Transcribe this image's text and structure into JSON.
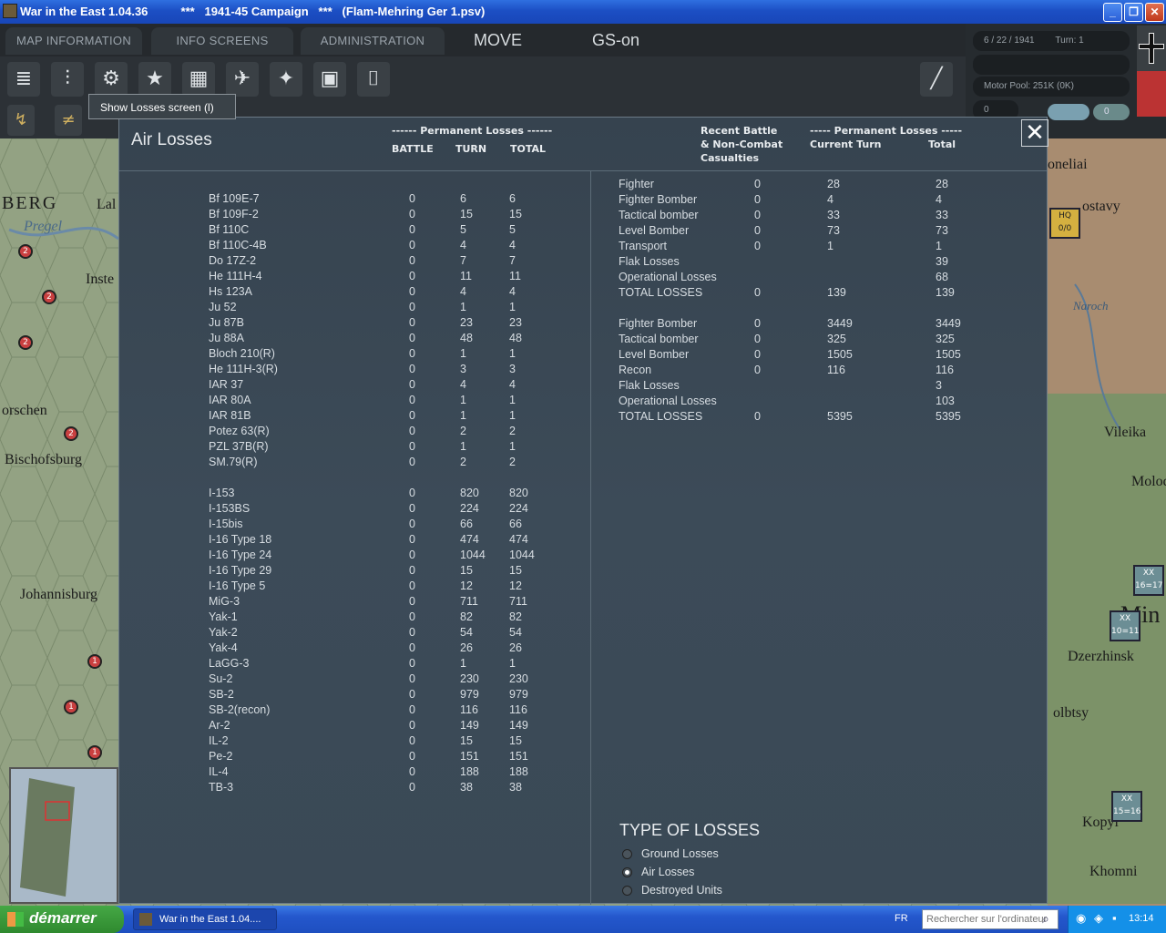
{
  "window": {
    "title": "War in the East 1.04.36          ***   1941-45 Campaign   ***   (Flam-Mehring Ger 1.psv)",
    "min": "_",
    "max": "❐",
    "close": "✕"
  },
  "menu": {
    "tabs": [
      "MAP INFORMATION",
      "INFO SCREENS",
      "ADMINISTRATION"
    ],
    "mode": "MOVE",
    "gs": "GS-on"
  },
  "status": {
    "date": "6 / 22 / 1941",
    "turn": "Turn: 1",
    "motor_pool": "Motor Pool:  251K (0K)",
    "zero": "0",
    "zero2": "0"
  },
  "tooltip": "Show Losses screen (l)",
  "map_labels": [
    "BERG",
    "Pregel",
    "Inste",
    "orschen",
    "Bischofsburg",
    "Johannisburg",
    "Lal"
  ],
  "right_map_labels": [
    "oneliai",
    "ostavy",
    "HQ",
    "0/0",
    "Naroch",
    "Vileika",
    "Molode",
    "Min",
    "Dzerzhinsk",
    "olbtsy",
    "Kopyl",
    "Khomni",
    "16=17",
    "10=11",
    "15=16"
  ],
  "panel": {
    "title": "Air Losses",
    "close": "✕",
    "left_header": "------ Permanent Losses ------",
    "col_battle": "BATTLE",
    "col_turn": "TURN",
    "col_total": "TOTAL",
    "right_header1": "Recent Battle",
    "right_header2": "& Non-Combat",
    "right_header3": "Casualties",
    "right_perm_header": "----- Permanent Losses -----",
    "right_current_turn": "Current Turn",
    "right_total": "Total",
    "german_aircraft": [
      [
        "Bf 109E-7",
        "0",
        "6",
        "6"
      ],
      [
        "Bf 109F-2",
        "0",
        "15",
        "15"
      ],
      [
        "Bf 110C",
        "0",
        "5",
        "5"
      ],
      [
        "Bf 110C-4B",
        "0",
        "4",
        "4"
      ],
      [
        "Do 17Z-2",
        "0",
        "7",
        "7"
      ],
      [
        "He 111H-4",
        "0",
        "11",
        "11"
      ],
      [
        "Hs 123A",
        "0",
        "4",
        "4"
      ],
      [
        "Ju 52",
        "0",
        "1",
        "1"
      ],
      [
        "Ju 87B",
        "0",
        "23",
        "23"
      ],
      [
        "Ju 88A",
        "0",
        "48",
        "48"
      ],
      [
        "Bloch 210(R)",
        "0",
        "1",
        "1"
      ],
      [
        "He 111H-3(R)",
        "0",
        "3",
        "3"
      ],
      [
        "IAR 37",
        "0",
        "4",
        "4"
      ],
      [
        "IAR 80A",
        "0",
        "1",
        "1"
      ],
      [
        "IAR 81B",
        "0",
        "1",
        "1"
      ],
      [
        "Potez 63(R)",
        "0",
        "2",
        "2"
      ],
      [
        "PZL 37B(R)",
        "0",
        "1",
        "1"
      ],
      [
        "SM.79(R)",
        "0",
        "2",
        "2"
      ]
    ],
    "soviet_aircraft": [
      [
        "I-153",
        "0",
        "820",
        "820"
      ],
      [
        "I-153BS",
        "0",
        "224",
        "224"
      ],
      [
        "I-15bis",
        "0",
        "66",
        "66"
      ],
      [
        "I-16 Type 18",
        "0",
        "474",
        "474"
      ],
      [
        "I-16 Type 24",
        "0",
        "1044",
        "1044"
      ],
      [
        "I-16 Type 29",
        "0",
        "15",
        "15"
      ],
      [
        "I-16 Type 5",
        "0",
        "12",
        "12"
      ],
      [
        "MiG-3",
        "0",
        "711",
        "711"
      ],
      [
        "Yak-1",
        "0",
        "82",
        "82"
      ],
      [
        "Yak-2",
        "0",
        "54",
        "54"
      ],
      [
        "Yak-4",
        "0",
        "26",
        "26"
      ],
      [
        "LaGG-3",
        "0",
        "1",
        "1"
      ],
      [
        "Su-2",
        "0",
        "230",
        "230"
      ],
      [
        "SB-2",
        "0",
        "979",
        "979"
      ],
      [
        "SB-2(recon)",
        "0",
        "116",
        "116"
      ],
      [
        "Ar-2",
        "0",
        "149",
        "149"
      ],
      [
        "IL-2",
        "0",
        "15",
        "15"
      ],
      [
        "Pe-2",
        "0",
        "151",
        "151"
      ],
      [
        "IL-4",
        "0",
        "188",
        "188"
      ],
      [
        "TB-3",
        "0",
        "38",
        "38"
      ]
    ],
    "german_summary": [
      [
        "Fighter",
        "0",
        "28",
        "28"
      ],
      [
        "Fighter Bomber",
        "0",
        "4",
        "4"
      ],
      [
        "Tactical bomber",
        "0",
        "33",
        "33"
      ],
      [
        "Level Bomber",
        "0",
        "73",
        "73"
      ],
      [
        "Transport",
        "0",
        "1",
        "1"
      ],
      [
        "Flak Losses",
        "",
        "",
        "39"
      ],
      [
        "Operational Losses",
        "",
        "",
        "68"
      ],
      [
        "TOTAL LOSSES",
        "0",
        "139",
        "139"
      ]
    ],
    "soviet_summary": [
      [
        "Fighter Bomber",
        "0",
        "3449",
        "3449"
      ],
      [
        "Tactical bomber",
        "0",
        "325",
        "325"
      ],
      [
        "Level Bomber",
        "0",
        "1505",
        "1505"
      ],
      [
        "Recon",
        "0",
        "116",
        "116"
      ],
      [
        "Flak Losses",
        "",
        "",
        "3"
      ],
      [
        "Operational Losses",
        "",
        "",
        "103"
      ],
      [
        "TOTAL LOSSES",
        "0",
        "5395",
        "5395"
      ]
    ],
    "type_title": "TYPE OF LOSSES",
    "type_options": [
      "Ground Losses",
      "Air Losses",
      "Destroyed Units"
    ],
    "type_selected": 1
  },
  "taskbar": {
    "start": "démarrer",
    "task": "War in the East 1.04....",
    "lang": "FR",
    "search_placeholder": "Rechercher sur l'ordinateur",
    "clock": "13:14"
  }
}
